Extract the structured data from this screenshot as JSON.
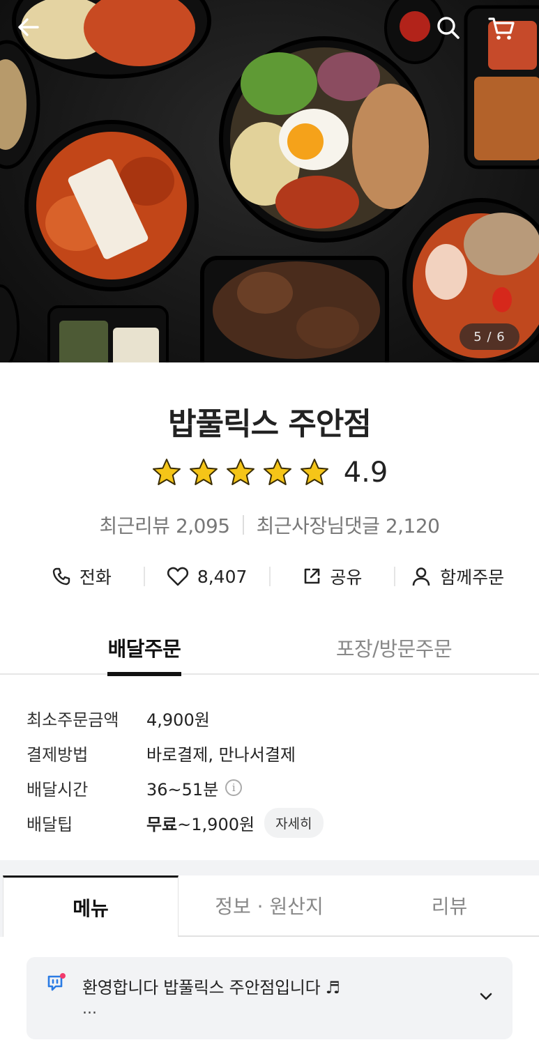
{
  "hero": {
    "image_alt": "food photo: bibimbap, kimchi tofu, bulgogi, seafood jjamppong",
    "counter": "5 / 6"
  },
  "icons": {
    "back": "arrow-left-icon",
    "search": "search-icon",
    "cart": "cart-icon"
  },
  "store": {
    "name": "밥풀릭스 주안점",
    "rating": "4.9",
    "star_count": 5,
    "recent_reviews": "최근리뷰 2,095",
    "recent_owner_replies": "최근사장님댓글 2,120"
  },
  "actions": {
    "call": "전화",
    "likes": "8,407",
    "share": "공유",
    "group_order": "함께주문"
  },
  "order_tabs": {
    "delivery": "배달주문",
    "pickup": "포장/방문주문"
  },
  "info": {
    "min_order_label": "최소주문금액",
    "min_order_value": "4,900원",
    "payment_label": "결제방법",
    "payment_value": "바로결제, 만나서결제",
    "delivery_time_label": "배달시간",
    "delivery_time_value": "36~51분",
    "delivery_tip_label": "배달팁",
    "delivery_tip_free": "무료",
    "delivery_tip_range": "~1,900원",
    "detail_button": "자세히"
  },
  "menu_tabs": {
    "menu": "메뉴",
    "info_origin": "정보 · 원산지",
    "reviews": "리뷰"
  },
  "notice": {
    "text": "환영합니다 밥풀릭스 주안점입니다 ♬",
    "more": "..."
  },
  "colors": {
    "star": "#F5C518",
    "accent_dot": "#F23A6B",
    "notice_icon": "#2A7BE4"
  }
}
